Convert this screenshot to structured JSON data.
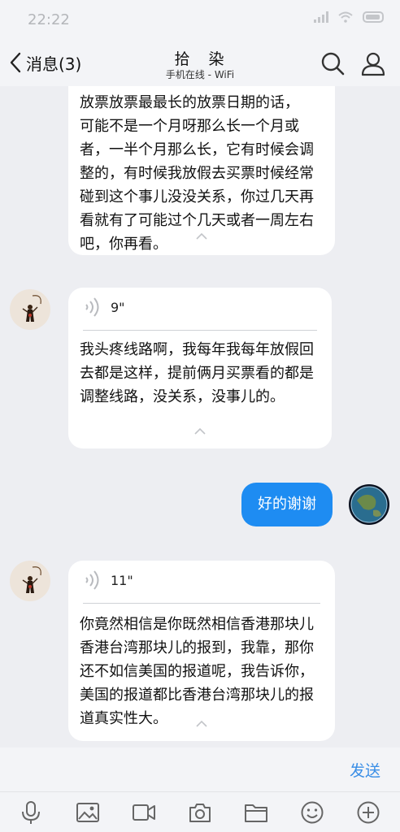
{
  "status_bar": {
    "time": "22:22"
  },
  "nav": {
    "back_label": "消息(3)",
    "title": "拾　染",
    "subtitle": "手机在线 - WiFi"
  },
  "messages": [
    {
      "id": "m1",
      "side": "received",
      "text": "可能不是一个月呀那么长一个月或者，一半个月那么长，它有时候会调整的，有时候我放假去买票时候经常碰到这个事儿没没关系，你过几天再看就有了可能过个几天或者一周左右吧，你再看。",
      "partial_lead": "放票放票最最长的放票日期的话，"
    },
    {
      "id": "m2",
      "side": "received",
      "duration": "9\"",
      "text": "我头疼线路啊，我每年我每年放假回去都是这样，提前俩月买票看的都是调整线路，没关系，没事儿的。"
    },
    {
      "id": "m3",
      "side": "sent",
      "text": "好的谢谢"
    },
    {
      "id": "m4",
      "side": "received",
      "duration": "11\"",
      "text": "你竟然相信是你既然相信香港那块儿香港台湾那块儿的报到，我靠，那你还不如信美国的报道呢，我告诉你，美国的报道都比香港台湾那块儿的报道真实性大。"
    }
  ],
  "input": {
    "send_label": "发送"
  },
  "toolbar": [
    "mic-icon",
    "image-icon",
    "video-icon",
    "camera-icon",
    "folder-icon",
    "emoji-icon",
    "plus-icon"
  ],
  "colors": {
    "accent": "#1e8cf2",
    "send_text": "#3a8ee6",
    "background": "#edeef2"
  }
}
